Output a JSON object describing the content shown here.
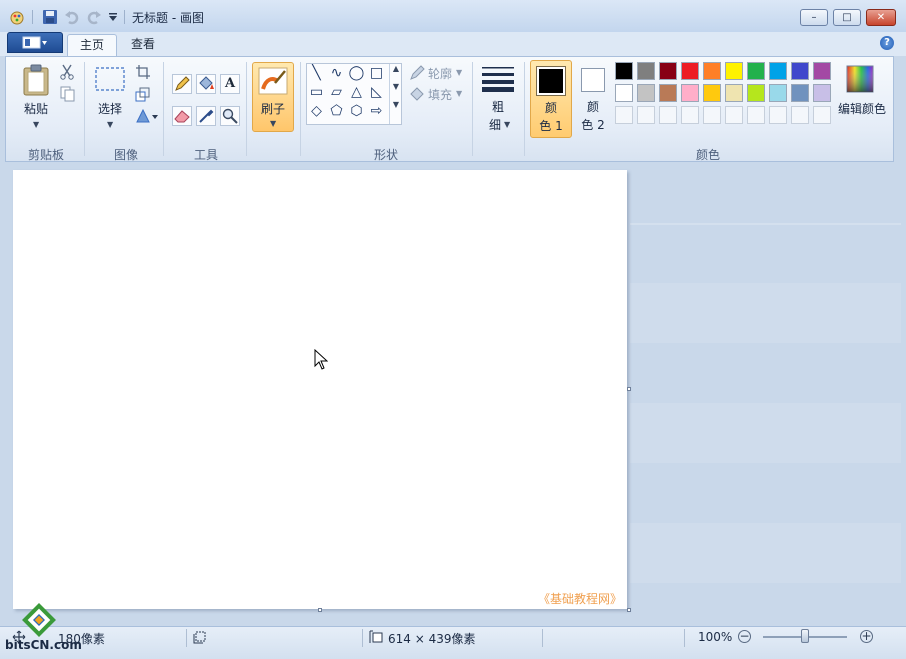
{
  "window": {
    "title": "无标题 - 画图",
    "controls": {
      "minimize": "–",
      "maximize": "□",
      "close": "✕"
    }
  },
  "tabs": [
    {
      "label": "主页",
      "active": true
    },
    {
      "label": "查看",
      "active": false
    }
  ],
  "help_glyph": "?",
  "ribbon": {
    "clipboard": {
      "paste_label": "粘贴",
      "group_label": "剪贴板"
    },
    "image": {
      "select_label": "选择",
      "group_label": "图像"
    },
    "tools": {
      "text_glyph": "A",
      "group_label": "工具"
    },
    "brush": {
      "label": "刷子"
    },
    "shapes": {
      "outline_label": "轮廓",
      "fill_label": "填充",
      "group_label": "形状",
      "glyphs": [
        "╲",
        "∿",
        "◯",
        "□",
        "▭",
        "▱",
        "△",
        "◺",
        "◇",
        "⬠",
        "⬡",
        "⇨"
      ]
    },
    "size": {
      "label_top": "粗",
      "label_bottom": "细"
    },
    "colors": {
      "color1_top": "颜",
      "color1_bottom": "色 1",
      "color2_top": "颜",
      "color2_bottom": "色 2",
      "edit_label": "编辑颜色",
      "group_label": "颜色",
      "color1": "#000000",
      "color2": "#ffffff",
      "palette_row1": [
        "#000000",
        "#7f7f7f",
        "#880015",
        "#ed1c24",
        "#ff7f27",
        "#fff200",
        "#22b14c",
        "#00a2e8",
        "#3f48cc",
        "#a349a4"
      ],
      "palette_row2": [
        "#ffffff",
        "#c3c3c3",
        "#b97a57",
        "#ffaec9",
        "#ffc90e",
        "#efe4b0",
        "#b5e61d",
        "#99d9ea",
        "#7092be",
        "#c8bfe7"
      ]
    }
  },
  "canvas": {
    "watermark": "《基础教程网》"
  },
  "status": {
    "cursor_pos": "180像素",
    "canvas_size": "614 × 439像素",
    "zoom": "100%",
    "zoom_level": 0.5,
    "zoom_minus": "−",
    "zoom_plus": "+"
  },
  "logo": {
    "text": "bitsCN.com"
  }
}
